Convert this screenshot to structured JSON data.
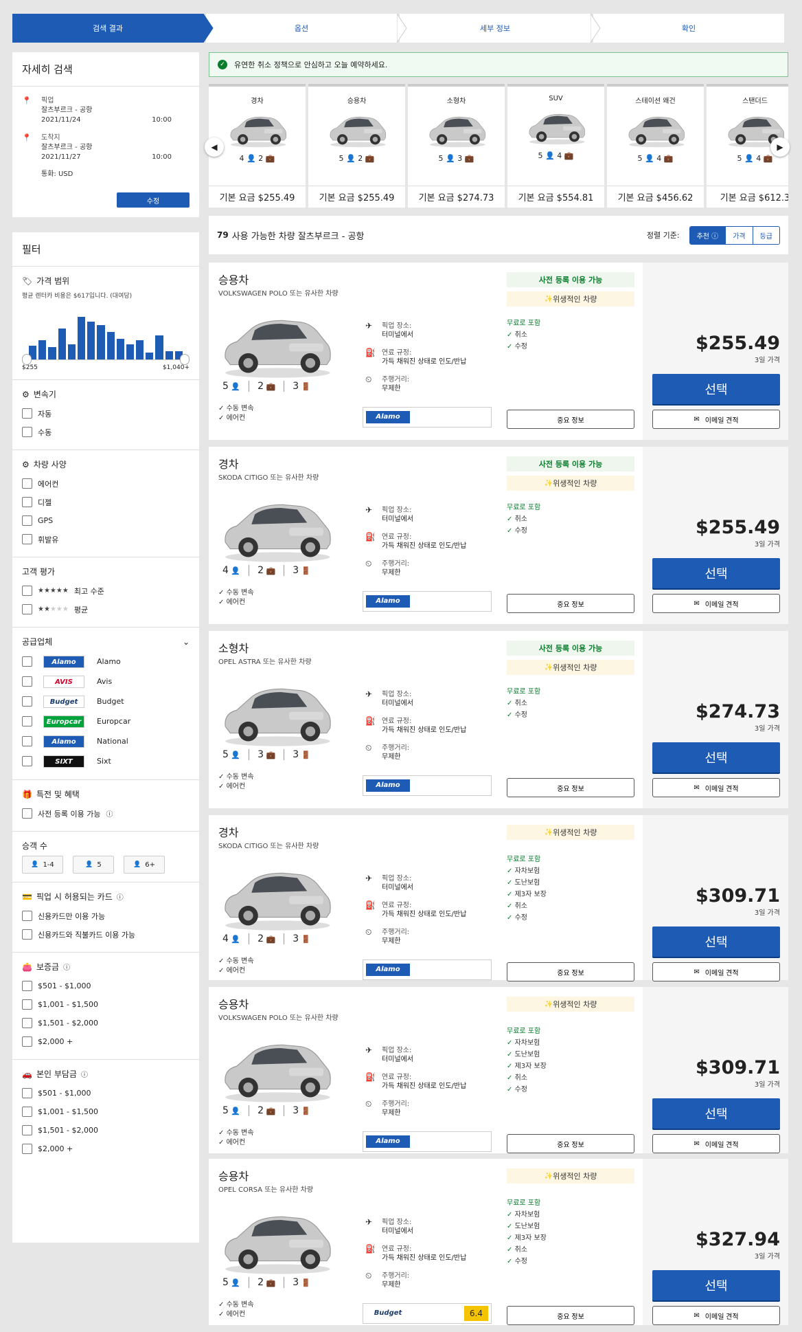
{
  "steps": [
    "검색 결과",
    "옵션",
    "세부 정보",
    "확인"
  ],
  "banner": "유연한 취소 정책으로 안심하고 오늘 예약하세요.",
  "search": {
    "title": "자세히 검색",
    "pickup_label": "픽업",
    "pickup_loc": "잘츠부르크 - 공항",
    "pickup_date": "2021/11/24",
    "pickup_time": "10:00",
    "dropoff_label": "도착지",
    "dropoff_loc": "잘츠부르크 - 공항",
    "dropoff_date": "2021/11/27",
    "dropoff_time": "10:00",
    "currency": "통화: USD",
    "edit": "수정"
  },
  "filters": {
    "title": "필터",
    "price_title": "가격 범위",
    "price_note": "평균 렌터카 비용은 $617입니다. (대여당)",
    "price_min": "$255",
    "price_max": "$1,040+",
    "histogram": [
      20,
      28,
      18,
      45,
      22,
      62,
      55,
      50,
      40,
      30,
      22,
      28,
      10,
      35,
      12,
      12
    ],
    "trans_title": "변속기",
    "trans": [
      "자동",
      "수동"
    ],
    "feat_title": "차량 사양",
    "feats": [
      "에어컨",
      "디젤",
      "GPS",
      "휘발유"
    ],
    "rating_title": "고객 평가",
    "rating_top": "최고 수준",
    "rating_avg": "평균",
    "supplier_title": "공급업체",
    "suppliers": [
      {
        "logo": "Alamo",
        "name": "Alamo",
        "bg": "#1e5bb4",
        "fg": "#fff"
      },
      {
        "logo": "AVIS",
        "name": "Avis",
        "bg": "#fff",
        "fg": "#d4002a"
      },
      {
        "logo": "Budget",
        "name": "Budget",
        "bg": "#fff",
        "fg": "#1b3d6d"
      },
      {
        "logo": "Europcar",
        "name": "Europcar",
        "bg": "#00a33c",
        "fg": "#fff"
      },
      {
        "logo": "Alamo",
        "name": "National",
        "bg": "#1e5bb4",
        "fg": "#fff"
      },
      {
        "logo": "SIXT",
        "name": "Sixt",
        "bg": "#111",
        "fg": "#fff"
      }
    ],
    "deal_title": "특전 및 혜택",
    "deal": "사전 등록 이용 가능",
    "pax_title": "승객 수",
    "pax": [
      "1-4",
      "5",
      "6+"
    ],
    "card_title": "픽업 시 허용되는 카드",
    "cards": [
      "신용카드만 이용 가능",
      "신용카드와 직불카드 이용 가능"
    ],
    "deposit_title": "보증금",
    "deposit": [
      "$501 - $1,000",
      "$1,001 - $1,500",
      "$1,501 - $2,000",
      "$2,000 +"
    ],
    "excess_title": "본인 부담금",
    "excess": [
      "$501 - $1,000",
      "$1,001 - $1,500",
      "$1,501 - $2,000",
      "$2,000 +"
    ]
  },
  "categories": [
    {
      "name": "경차",
      "spec": "4 👤 2 💼",
      "price": "기본 요금 $255.49"
    },
    {
      "name": "승용차",
      "spec": "5 👤 2 💼",
      "price": "기본 요금 $255.49"
    },
    {
      "name": "소형차",
      "spec": "5 👤 3 💼",
      "price": "기본 요금 $274.73"
    },
    {
      "name": "SUV",
      "spec": "5 👤 4 💼",
      "price": "기본 요금 $554.81"
    },
    {
      "name": "스테이션 왜건",
      "spec": "5 👤 4 💼",
      "price": "기본 요금 $456.62"
    },
    {
      "name": "스탠더드",
      "spec": "5 👤 4 💼",
      "price": "기본 요금 $612.3"
    }
  ],
  "results": {
    "count": "79",
    "text": "사용 가능한 차량 잘츠부르크 - 공항",
    "sort_label": "정렬 기준:",
    "sort": [
      "추천",
      "가격",
      "등급"
    ]
  },
  "labels": {
    "pickup": "픽업 장소:",
    "pickup_val": "터미널에서",
    "fuel": "연료 규정:",
    "fuel_val": "가득 채워진 상태로 인도/반납",
    "mileage": "주행거리:",
    "mileage_val": "무제한",
    "precheck": "사전 등록 이용 가능",
    "clean": "위생적인 차량",
    "included": "무료로 포함",
    "info": "중요 정보",
    "select": "선택",
    "email": "이메일 견적",
    "f1": "수동 변속",
    "f2": "에어컨"
  },
  "cars": [
    {
      "cls": "승용차",
      "model": "VOLKSWAGEN POLO 또는 유사한 차량",
      "pax": "5",
      "bags": "2",
      "doors": "3",
      "pre": true,
      "incl": [
        "취소",
        "수정"
      ],
      "price": "$255.49",
      "days": "3일 가격",
      "vendor": "Alamo",
      "score": ""
    },
    {
      "cls": "경차",
      "model": "SKODA CITIGO 또는 유사한 차량",
      "pax": "4",
      "bags": "2",
      "doors": "3",
      "pre": true,
      "incl": [
        "취소",
        "수정"
      ],
      "price": "$255.49",
      "days": "3일 가격",
      "vendor": "Alamo",
      "score": ""
    },
    {
      "cls": "소형차",
      "model": "OPEL ASTRA 또는 유사한 차량",
      "pax": "5",
      "bags": "3",
      "doors": "3",
      "pre": true,
      "incl": [
        "취소",
        "수정"
      ],
      "price": "$274.73",
      "days": "3일 가격",
      "vendor": "Alamo",
      "score": ""
    },
    {
      "cls": "경차",
      "model": "SKODA CITIGO 또는 유사한 차량",
      "pax": "4",
      "bags": "2",
      "doors": "3",
      "pre": false,
      "incl": [
        "자차보험",
        "도난보험",
        "제3자 보장",
        "취소",
        "수정"
      ],
      "price": "$309.71",
      "days": "3일 가격",
      "vendor": "Alamo",
      "score": ""
    },
    {
      "cls": "승용차",
      "model": "VOLKSWAGEN POLO 또는 유사한 차량",
      "pax": "5",
      "bags": "2",
      "doors": "3",
      "pre": false,
      "incl": [
        "자차보험",
        "도난보험",
        "제3자 보장",
        "취소",
        "수정"
      ],
      "price": "$309.71",
      "days": "3일 가격",
      "vendor": "Alamo",
      "score": ""
    },
    {
      "cls": "승용차",
      "model": "OPEL CORSA 또는 유사한 차량",
      "pax": "5",
      "bags": "2",
      "doors": "3",
      "pre": false,
      "incl": [
        "자차보험",
        "도난보험",
        "제3자 보장",
        "취소",
        "수정"
      ],
      "price": "$327.94",
      "days": "3일 가격",
      "vendor": "Budget",
      "score": "6.4"
    }
  ]
}
